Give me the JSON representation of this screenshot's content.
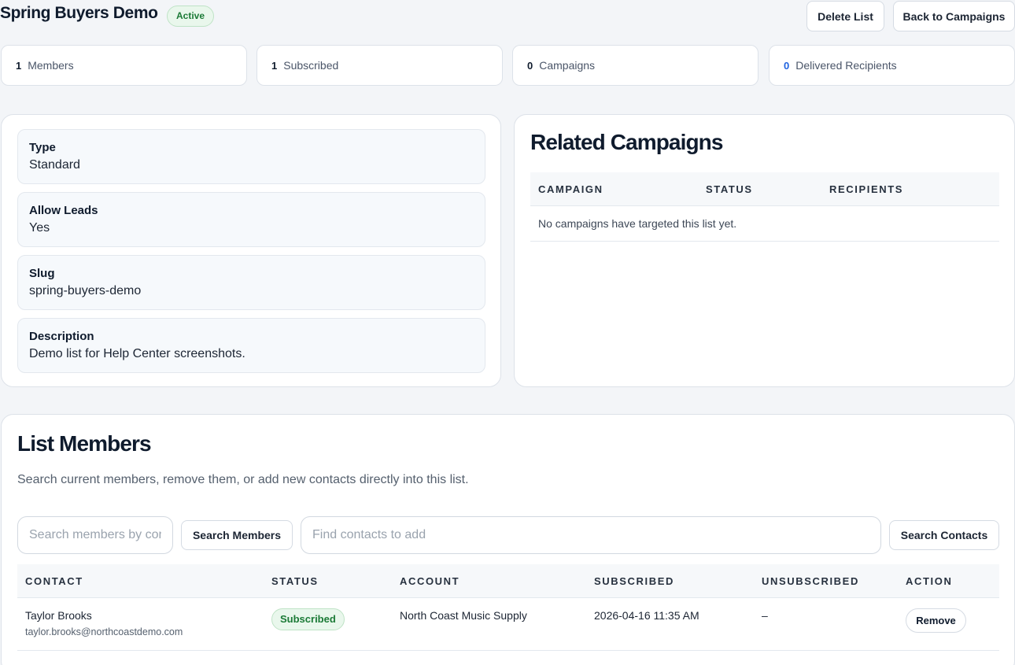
{
  "header": {
    "title": "Spring Buyers Demo",
    "status": "Active",
    "delete_label": "Delete List",
    "back_label": "Back to Campaigns"
  },
  "stats": [
    {
      "value": "1",
      "label": "Members"
    },
    {
      "value": "1",
      "label": "Subscribed"
    },
    {
      "value": "0",
      "label": "Campaigns"
    },
    {
      "value": "0",
      "label": "Delivered Recipients"
    }
  ],
  "details": [
    {
      "label": "Type",
      "value": "Standard"
    },
    {
      "label": "Allow Leads",
      "value": "Yes"
    },
    {
      "label": "Slug",
      "value": "spring-buyers-demo"
    },
    {
      "label": "Description",
      "value": "Demo list for Help Center screenshots."
    }
  ],
  "related": {
    "title": "Related Campaigns",
    "columns": [
      "CAMPAIGN",
      "STATUS",
      "RECIPIENTS"
    ],
    "empty_text": "No campaigns have targeted this list yet."
  },
  "members": {
    "title": "List Members",
    "subtitle": "Search current members, remove them, or add new contacts directly into this list.",
    "search_members_placeholder": "Search members by contact",
    "search_members_button": "Search Members",
    "find_contacts_placeholder": "Find contacts to add",
    "search_contacts_button": "Search Contacts",
    "columns": [
      "CONTACT",
      "STATUS",
      "ACCOUNT",
      "SUBSCRIBED",
      "UNSUBSCRIBED",
      "ACTION"
    ],
    "rows": [
      {
        "name": "Taylor Brooks",
        "email": "taylor.brooks@northcoastdemo.com",
        "status": "Subscribed",
        "account": "North Coast Music Supply",
        "subscribed": "2026-04-16 11:35 AM",
        "unsubscribed": "–",
        "action": "Remove"
      }
    ]
  },
  "colors": {
    "accent_blue": "#1f63e0",
    "success_green": "#1b7a36",
    "success_bg": "#e9f7ec"
  }
}
